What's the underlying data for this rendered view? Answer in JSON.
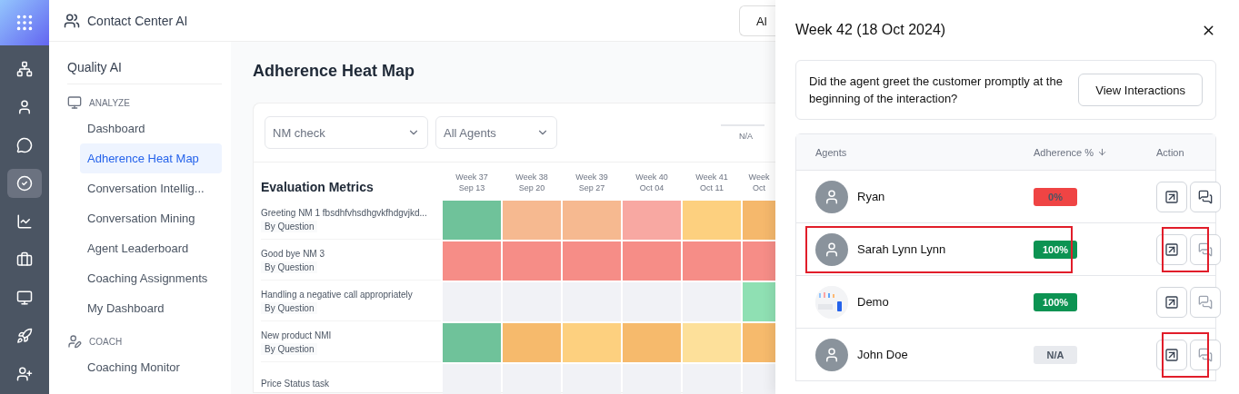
{
  "app_bar": {
    "title": "Contact Center AI",
    "control": "Al"
  },
  "rail": {
    "items": [
      {
        "kind": "sitemap",
        "selected": false
      },
      {
        "kind": "user",
        "selected": false
      },
      {
        "kind": "chat",
        "selected": false
      },
      {
        "kind": "check",
        "selected": true
      },
      {
        "kind": "chart",
        "selected": false
      },
      {
        "kind": "briefcase",
        "selected": false
      },
      {
        "kind": "monitor",
        "selected": false
      },
      {
        "kind": "rocket",
        "selected": false
      },
      {
        "kind": "user-plus",
        "selected": false
      }
    ]
  },
  "sidebar": {
    "title": "Quality AI",
    "sections": [
      {
        "heading": "ANALYZE",
        "kind": "monitor",
        "items": [
          {
            "label": "Dashboard",
            "selected": false
          },
          {
            "label": "Adherence Heat Map",
            "selected": true
          },
          {
            "label": "Conversation Intellig...",
            "selected": false
          },
          {
            "label": "Conversation Mining",
            "selected": false
          },
          {
            "label": "Agent Leaderboard",
            "selected": false
          },
          {
            "label": "Coaching Assignments",
            "selected": false
          },
          {
            "label": "My Dashboard",
            "selected": false
          }
        ]
      },
      {
        "heading": "COACH",
        "kind": "coach",
        "items": [
          {
            "label": "Coaching Monitor",
            "selected": false
          }
        ]
      }
    ]
  },
  "page": {
    "title": "Adherence Heat Map",
    "filters": [
      "NM check",
      "All Agents"
    ],
    "legend": "N/A",
    "heatmap": {
      "heading": "Evaluation Metrics",
      "columns": [
        {
          "week": "Week 37",
          "date": "Sep 13"
        },
        {
          "week": "Week 38",
          "date": "Sep 20"
        },
        {
          "week": "Week 39",
          "date": "Sep 27"
        },
        {
          "week": "Week 40",
          "date": "Oct 04"
        },
        {
          "week": "Week 41",
          "date": "Oct 11"
        },
        {
          "week": "Week",
          "date": "Oct"
        }
      ],
      "rows": [
        {
          "label": "Greeting NM 1 fbsdhfvhsdhgvkfhdgvjkd...",
          "tag": "By Question",
          "cells": [
            {
              "color": "#6fc29a"
            },
            {
              "color": "#f6b990"
            },
            {
              "color": "#f6b990"
            },
            {
              "color": "#f8a8a2"
            },
            {
              "color": "#fdd07f"
            },
            {
              "color": "#f5b86c"
            }
          ]
        },
        {
          "label": "Good bye NM 3",
          "tag": "By Question",
          "cells": [
            {
              "color": "#f68d87"
            },
            {
              "color": "#f68d87"
            },
            {
              "color": "#f68d87"
            },
            {
              "color": "#f68d87"
            },
            {
              "color": "#f68d87"
            },
            {
              "color": "#f68d87"
            }
          ]
        },
        {
          "label": "Handling a negative call appropriately",
          "tag": "By Question",
          "cells": [
            {
              "color": "#f1f2f6"
            },
            {
              "color": "#f1f2f6"
            },
            {
              "color": "#f1f2f6"
            },
            {
              "color": "#f1f2f6"
            },
            {
              "color": "#f1f2f6"
            },
            {
              "color": "#8fe0b3"
            }
          ]
        },
        {
          "label": "New product NMI",
          "tag": "By Question",
          "cells": [
            {
              "color": "#6fc29a"
            },
            {
              "color": "#f6ba6c"
            },
            {
              "color": "#fdd07f"
            },
            {
              "color": "#f6ba6c"
            },
            {
              "color": "#fde09a"
            },
            {
              "color": "#f6ba6c"
            }
          ]
        },
        {
          "label": "Price Status task",
          "cells": [
            {
              "color": "#f1f2f6"
            },
            {
              "color": "#f1f2f6"
            },
            {
              "color": "#f1f2f6"
            },
            {
              "color": "#f1f2f6"
            },
            {
              "color": "#f1f2f6"
            },
            {
              "color": "#f1f2f6"
            }
          ]
        }
      ]
    }
  },
  "drawer": {
    "title": "Week 42 (18 Oct 2024)",
    "question": "Did the agent greet the customer promptly at the beginning of the interaction?",
    "button": "View Interactions",
    "table": {
      "columns": [
        "Agents",
        "Adherence %",
        "Action"
      ],
      "rows": [
        {
          "name": "Ryan",
          "kind": "person",
          "adherence": "0%",
          "color": "#ef4444",
          "highlighted": false,
          "chat_highlighted": false
        },
        {
          "name": "Sarah Lynn Lynn",
          "kind": "person",
          "adherence": "100%",
          "color": "#0c9352",
          "highlighted": true,
          "chat_highlighted": true
        },
        {
          "name": "Demo",
          "kind": "picture",
          "adherence": "100%",
          "color": "#0c9352",
          "highlighted": false,
          "chat_highlighted": false
        },
        {
          "name": "John Doe",
          "kind": "person",
          "adherence": "N/A",
          "color": "#e8eaee",
          "highlighted": false,
          "chat_highlighted": true
        }
      ]
    }
  }
}
